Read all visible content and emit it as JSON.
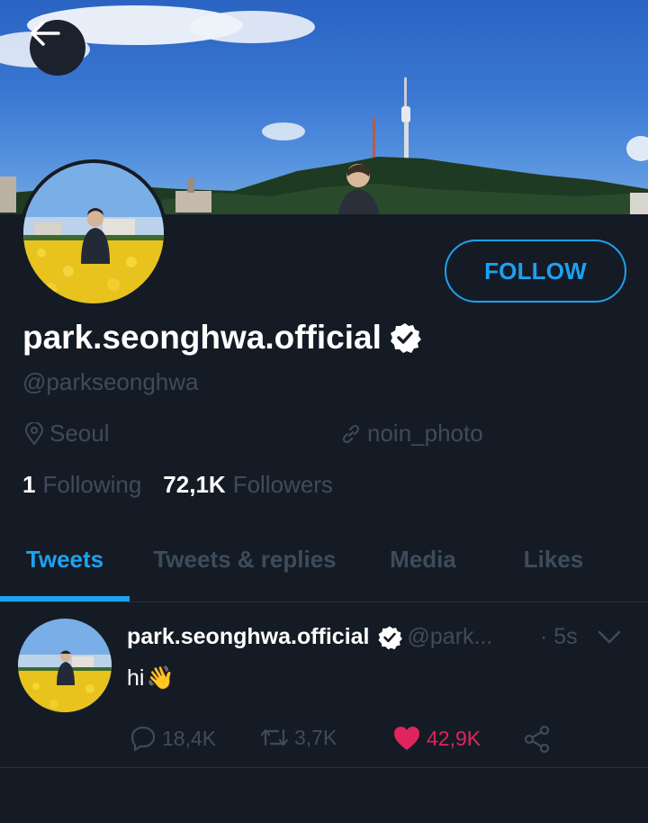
{
  "profile": {
    "display_name": "park.seonghwa.official",
    "handle": "@parkseonghwa",
    "location": "Seoul",
    "website": "noin_photo",
    "following_count": "1",
    "following_label": "Following",
    "followers_count": "72,1K",
    "followers_label": "Followers",
    "follow_label": "FOLLOW"
  },
  "tabs": [
    {
      "label": "Tweets",
      "active": true
    },
    {
      "label": "Tweets & replies",
      "active": false
    },
    {
      "label": "Media",
      "active": false
    },
    {
      "label": "Likes",
      "active": false
    }
  ],
  "tweet": {
    "name": "park.seonghwa.official",
    "handle": "@park...",
    "time": "· 5s",
    "text": "hi",
    "emoji": "👋",
    "replies": "18,4K",
    "retweets": "3,7K",
    "likes": "42,9K"
  },
  "colors": {
    "background": "#151b24",
    "accent": "#1da1f2",
    "muted": "#3d4c5c",
    "like": "#e0245e"
  },
  "icons": {
    "back": "arrow-left-icon",
    "verified": "verified-badge-icon",
    "location": "location-pin-icon",
    "link": "link-icon",
    "reply": "reply-bubble-icon",
    "retweet": "retweet-icon",
    "like": "heart-icon",
    "share": "share-icon",
    "caret": "chevron-down-icon"
  }
}
